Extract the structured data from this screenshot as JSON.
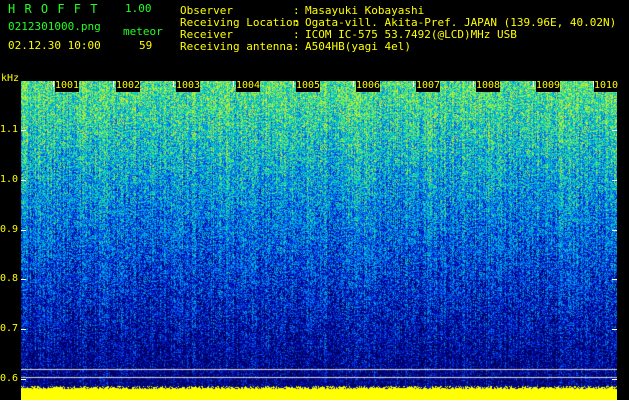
{
  "header": {
    "app_name": "H R O F F T",
    "version": "1.00",
    "filename": "0212301000.png",
    "datetime": "02.12.30 10:00",
    "count_label": "meteor",
    "count_value": "59"
  },
  "info": [
    {
      "key": "Observer",
      "sep": ":",
      "value": "Masayuki Kobayashi"
    },
    {
      "key": "Receiving Location",
      "sep": ":",
      "value": "Ogata-vill. Akita-Pref. JAPAN (139.96E, 40.02N)"
    },
    {
      "key": "Receiver",
      "sep": ":",
      "value": "ICOM IC-575 53.7492(@LCD)MHz USB"
    },
    {
      "key": "Receiving antenna",
      "sep": ":",
      "value": "A504HB(yagi 4el)"
    }
  ],
  "y_axis": {
    "unit": "kHz",
    "ticks": [
      "1.1",
      "1.0",
      "0.9",
      "0.8",
      "0.7",
      "0.6"
    ]
  },
  "x_axis": {
    "ticks": [
      "1001",
      "1002",
      "1003",
      "1004",
      "1005",
      "1006",
      "1007",
      "1008",
      "1009",
      "1010"
    ]
  }
}
